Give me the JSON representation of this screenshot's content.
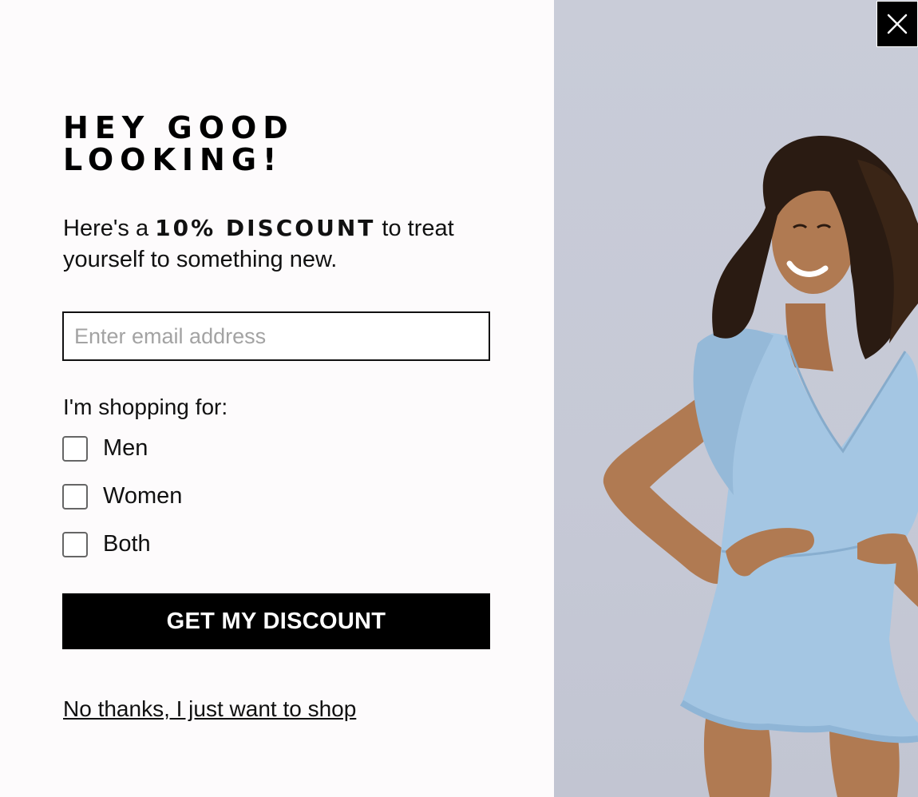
{
  "popup": {
    "heading": "HEY GOOD LOOKING!",
    "subtext_before": "Here's a ",
    "subtext_strong": "10% DISCOUNT",
    "subtext_after": " to treat yourself to something new.",
    "email": {
      "value": "",
      "placeholder": "Enter email address"
    },
    "shopping_label": "I'm shopping for:",
    "options": [
      {
        "label": "Men",
        "checked": false
      },
      {
        "label": "Women",
        "checked": false
      },
      {
        "label": "Both",
        "checked": false
      }
    ],
    "cta_label": "GET MY DISCOUNT",
    "decline_link": "No thanks, I just want to shop",
    "close_icon": "close-icon",
    "colors": {
      "button": "#000000",
      "button_text": "#ffffff",
      "photo_background": "#c9ccd8",
      "outfit": "#a3c5e2"
    }
  }
}
